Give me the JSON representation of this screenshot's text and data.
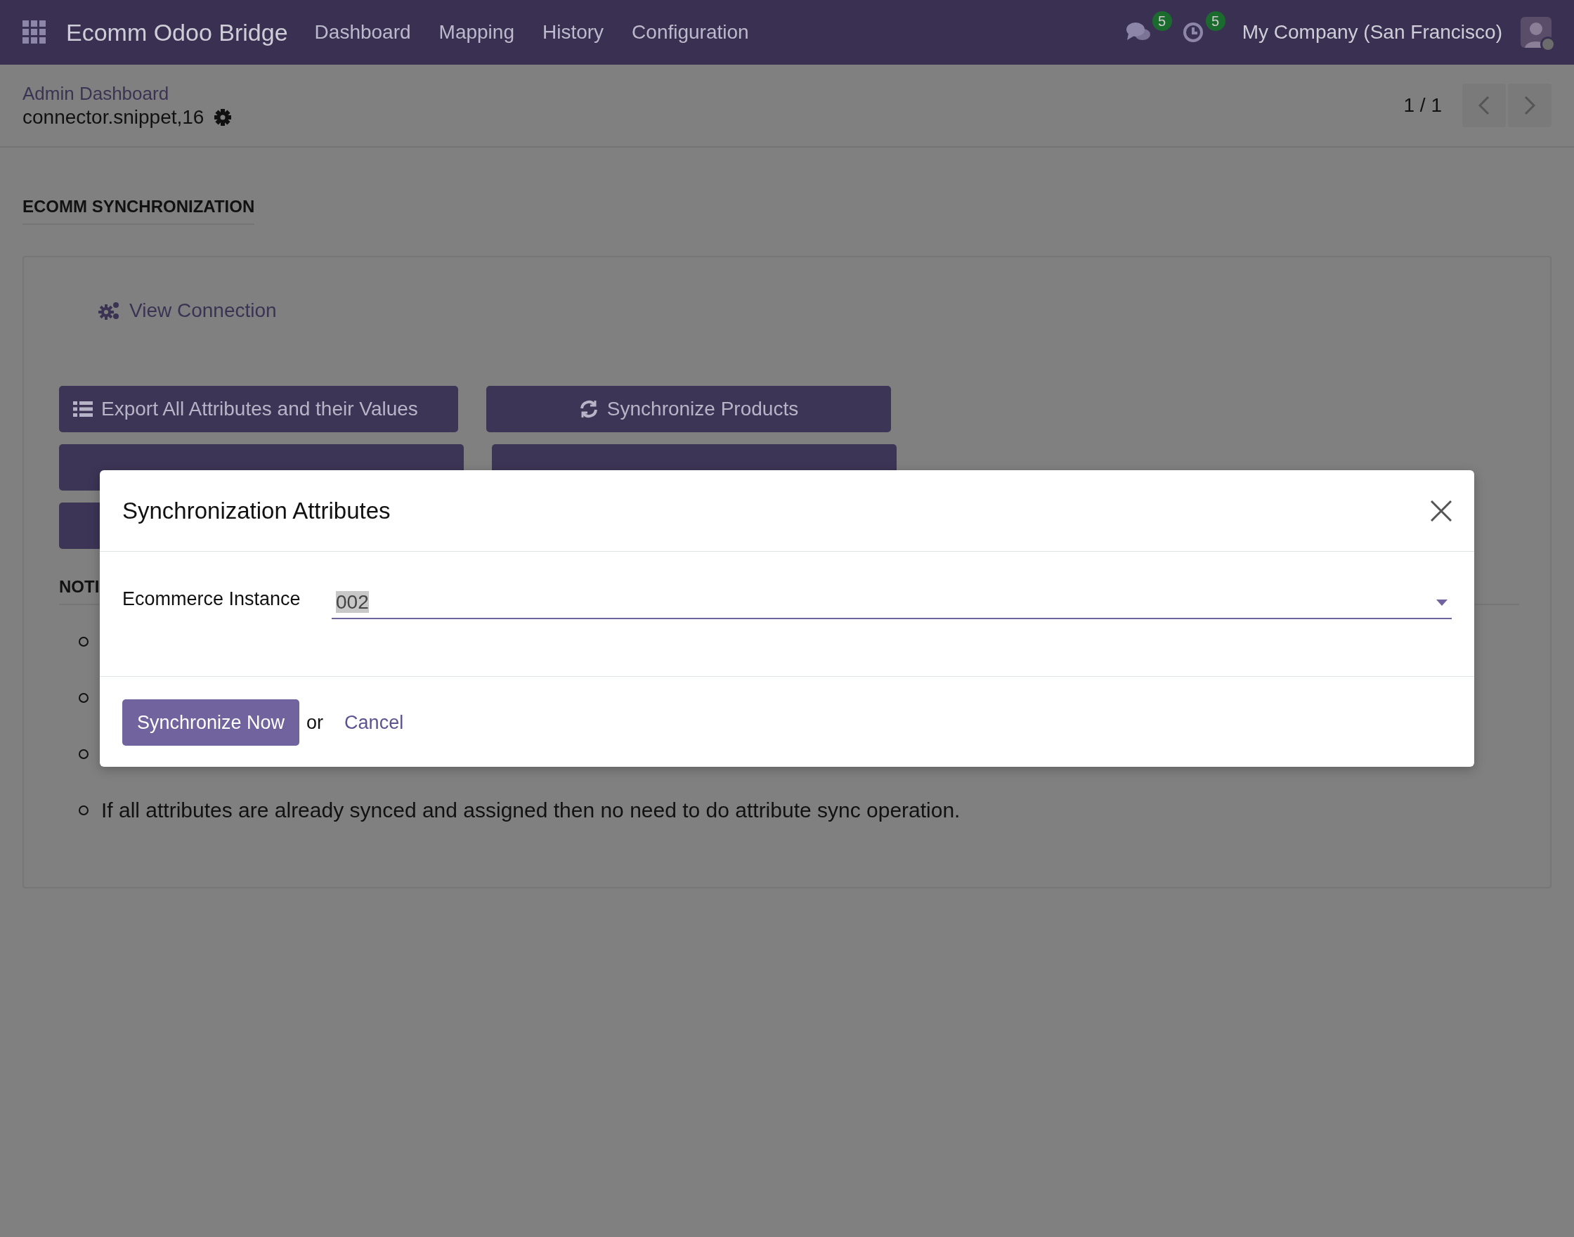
{
  "navbar": {
    "app_name": "Ecomm Odoo Bridge",
    "menu": [
      "Dashboard",
      "Mapping",
      "History",
      "Configuration"
    ],
    "messages_count": "5",
    "activities_count": "5",
    "company": "My Company (San Francisco)"
  },
  "breadcrumb": {
    "parent": "Admin Dashboard",
    "record": "connector.snippet,16"
  },
  "pager": {
    "value": "1 / 1"
  },
  "section_title": "ECOMM SYNCHRONIZATION",
  "view_connection": "View Connection",
  "actions": [
    "Export All Attributes and their Values",
    "Synchronize Products"
  ],
  "notes": {
    "heading": "NOTI",
    "items": [
      "If all attributes are already synced and assigned then no need to do attribute sync operation."
    ]
  },
  "dialog": {
    "title": "Synchronization Attributes",
    "field_label": "Ecommerce Instance",
    "field_value": "002",
    "primary_button": "Synchronize Now",
    "separator": "or",
    "cancel": "Cancel"
  }
}
